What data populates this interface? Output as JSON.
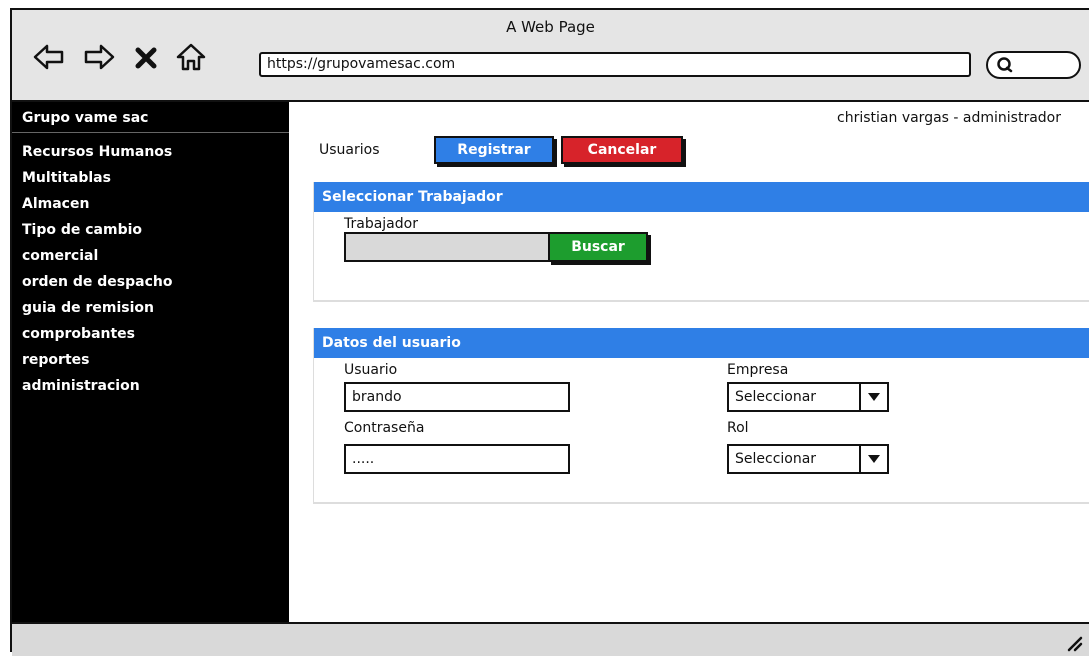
{
  "window": {
    "title": "A Web Page"
  },
  "browser": {
    "url": "https://grupovamesac.com"
  },
  "sidebar": {
    "brand": "Grupo vame sac",
    "items": [
      {
        "label": "Recursos Humanos"
      },
      {
        "label": "Multitablas"
      },
      {
        "label": "Almacen"
      },
      {
        "label": "Tipo de cambio"
      },
      {
        "label": "comercial"
      },
      {
        "label": "orden de despacho"
      },
      {
        "label": "guia de remision"
      },
      {
        "label": "comprobantes"
      },
      {
        "label": "reportes"
      },
      {
        "label": "administracion"
      }
    ]
  },
  "header": {
    "user": "christian vargas - administrador"
  },
  "toolbar": {
    "page_label": "Usuarios",
    "register_label": "Registrar",
    "cancel_label": "Cancelar"
  },
  "worker_panel": {
    "title": "Seleccionar Trabajador",
    "field_label": "Trabajador",
    "field_value": "",
    "search_label": "Buscar"
  },
  "user_panel": {
    "title": "Datos del usuario",
    "username_label": "Usuario",
    "username_value": "brando",
    "password_label": "Contraseña",
    "password_value": ".....",
    "company_label": "Empresa",
    "company_value": "Seleccionar",
    "role_label": "Rol",
    "role_value": "Seleccionar"
  },
  "colors": {
    "primary": "#2f7fe6",
    "danger": "#d7232a",
    "success": "#1d9d2e",
    "sidebar_bg": "#000000"
  }
}
